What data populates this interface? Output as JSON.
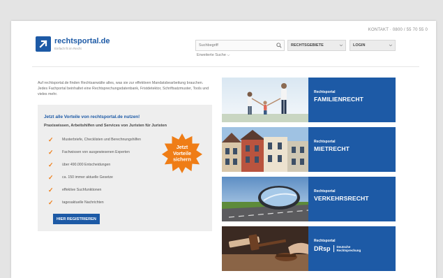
{
  "header": {
    "top_links": "KONTAKT · 0800 / 55 70 55 0",
    "logo_name": "rechtsportal.de",
    "logo_tagline": "Einfach fit im Recht",
    "search_placeholder": "Suchbegriff",
    "advanced_search": "Erweiterte Suche",
    "nav_legal": "RECHTSGEBIETE",
    "nav_login": "LOGIN"
  },
  "intro": "Auf rechtsportal.de finden Rechtsanwälte alles, was sie zur effektiven Mandatsbearbeitung brauchen. Jedes Fachportal beinhaltet eine Rechtsprechungsdatenbank, Fristdetektor, Schriftsatzmuster, Tools und vieles mehr.",
  "promo": {
    "title": "Jetzt alle Vorteile von rechtsportal.de nutzen!",
    "subtitle": "Praxiswissen, Arbeitshilfen und Services von Juristen für Juristen",
    "benefits": [
      "Musterbriefe, Checklisten und Berechnungshilfen",
      "Fachwissen von ausgewiesenen Experten",
      "über 490.000 Entscheidungen",
      "ca. 150 immer aktuelle Gesetze",
      "effektive Suchfunktionen",
      "tagesaktuelle Nachrichten"
    ],
    "badge": [
      "Jetzt",
      "Vorteile",
      "sichern"
    ],
    "register_button": "HIER REGISTRIEREN"
  },
  "tiles": [
    {
      "pre": "Rechtsportal",
      "name": "FAMILIENRECHT"
    },
    {
      "pre": "Rechtsportal",
      "name": "MIETRECHT"
    },
    {
      "pre": "Rechtsportal",
      "name": "VERKEHRSRECHT"
    },
    {
      "pre": "Rechtsportal",
      "logo": "DRsp",
      "desc_line1": "Deutsche",
      "desc_line2": "Rechtsprechung"
    }
  ],
  "colors": {
    "brand_blue": "#1d5aa6",
    "accent_orange": "#ef7d16"
  }
}
